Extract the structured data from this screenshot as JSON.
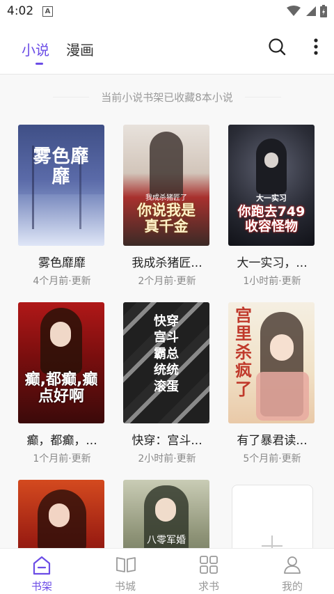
{
  "status_bar": {
    "time": "4:02",
    "notification_letter": "A"
  },
  "top_tabs": [
    {
      "label": "小说",
      "active": true
    },
    {
      "label": "漫画",
      "active": false
    }
  ],
  "shelf_summary": "当前小说书架已收藏8本小说",
  "books": [
    {
      "title": "雾色靡靡",
      "updated": "4个月前·更新",
      "cover_text": "雾色靡靡"
    },
    {
      "title": "我成杀猪匠...",
      "updated": "2个月前·更新",
      "cover_text": "你说我是真千金",
      "cover_subtext": "我成杀猪匠了"
    },
    {
      "title": "大一实习，...",
      "updated": "1小时前·更新",
      "cover_text": "你跑去749收容怪物",
      "cover_subtext": "大一实习"
    },
    {
      "title": "癫，都癫，...",
      "updated": "1个月前·更新",
      "cover_text": "癫,都癫,癫点好啊"
    },
    {
      "title": "快穿：宫斗...",
      "updated": "2小时前·更新",
      "cover_text": "快穿宫斗霸总统统滚蛋"
    },
    {
      "title": "有了暴君读...",
      "updated": "5个月前·更新",
      "cover_text": "宫里杀疯了"
    },
    {
      "title": "",
      "updated": "",
      "cover_text": ""
    },
    {
      "title": "",
      "updated": "",
      "cover_text": "八零军婚"
    }
  ],
  "bottom_nav": [
    {
      "label": "书架",
      "icon": "bookshelf-icon",
      "active": true
    },
    {
      "label": "书城",
      "icon": "book-open-icon",
      "active": false
    },
    {
      "label": "求书",
      "icon": "grid-icon",
      "active": false
    },
    {
      "label": "我的",
      "icon": "user-icon",
      "active": false
    }
  ],
  "colors": {
    "accent": "#6b4ce6",
    "muted": "#999999",
    "background": "#f8f8f8"
  }
}
